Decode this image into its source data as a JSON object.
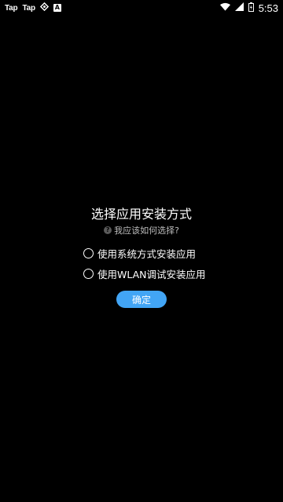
{
  "status_bar": {
    "notifications": [
      "Tap",
      "Tap"
    ],
    "icons": [
      "tap-icon",
      "tap-icon",
      "sync-icon",
      "accessibility-a-icon"
    ],
    "a_glyph": "A",
    "right_icons": [
      "wifi-icon",
      "signal-icon",
      "battery-icon"
    ],
    "time": "5:53"
  },
  "dialog": {
    "title": "选择应用安装方式",
    "help_text": "我应该如何选择?",
    "help_glyph": "?",
    "options": [
      {
        "label": "使用系统方式安装应用",
        "selected": false
      },
      {
        "label": "使用WLAN调试安装应用",
        "selected": false
      }
    ],
    "confirm_label": "确定"
  },
  "colors": {
    "background": "#000000",
    "accent": "#42a5f5",
    "text": "#ffffff"
  }
}
